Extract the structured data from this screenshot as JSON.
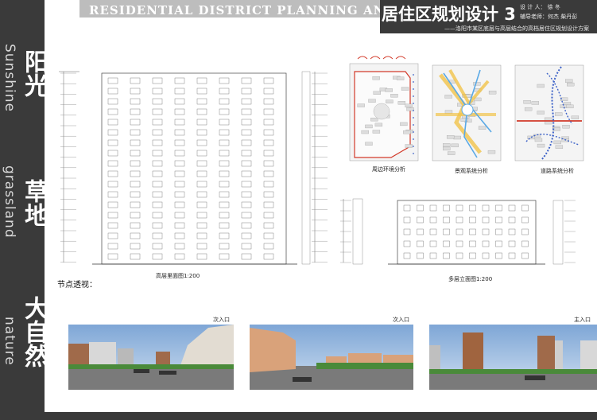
{
  "header": {
    "banner_text": "RESIDENTIAL DISTRICT PLANNING AND DESIGN",
    "title": "居住区规划设计 3",
    "designer": "设 计 人： 徐 冬",
    "advisor": "辅导老师：何杰 柴丹彭",
    "subtitle": "——洛阳市某区底层与高层结合的高档居住区规划设计方案"
  },
  "sidebar": {
    "words": [
      {
        "cjk": "阳光",
        "latin": "Sunshine"
      },
      {
        "cjk": "草地",
        "latin": "grassland"
      },
      {
        "cjk": "大自然",
        "latin": "nature"
      }
    ]
  },
  "drawings": {
    "high_rise_caption": "高层里面图1:200",
    "multi_storey_caption": "多层立面图1:200",
    "node_label": "节点透视：",
    "analysis": [
      {
        "caption": "周边环境分析"
      },
      {
        "caption": "景观系统分析"
      },
      {
        "caption": "道路系统分析"
      }
    ]
  },
  "perspectives": [
    {
      "label": "次入口"
    },
    {
      "label": "次入口"
    },
    {
      "label": "主入口"
    }
  ],
  "colors": {
    "dark": "#3a3a3a",
    "banner": "#bdbdbd",
    "sky_top": "#8fb3da",
    "ground": "#7a7a7a",
    "road_red": "#d23a2a",
    "road_blue": "#3d62c8",
    "landscape_yellow": "#f1c34a"
  }
}
